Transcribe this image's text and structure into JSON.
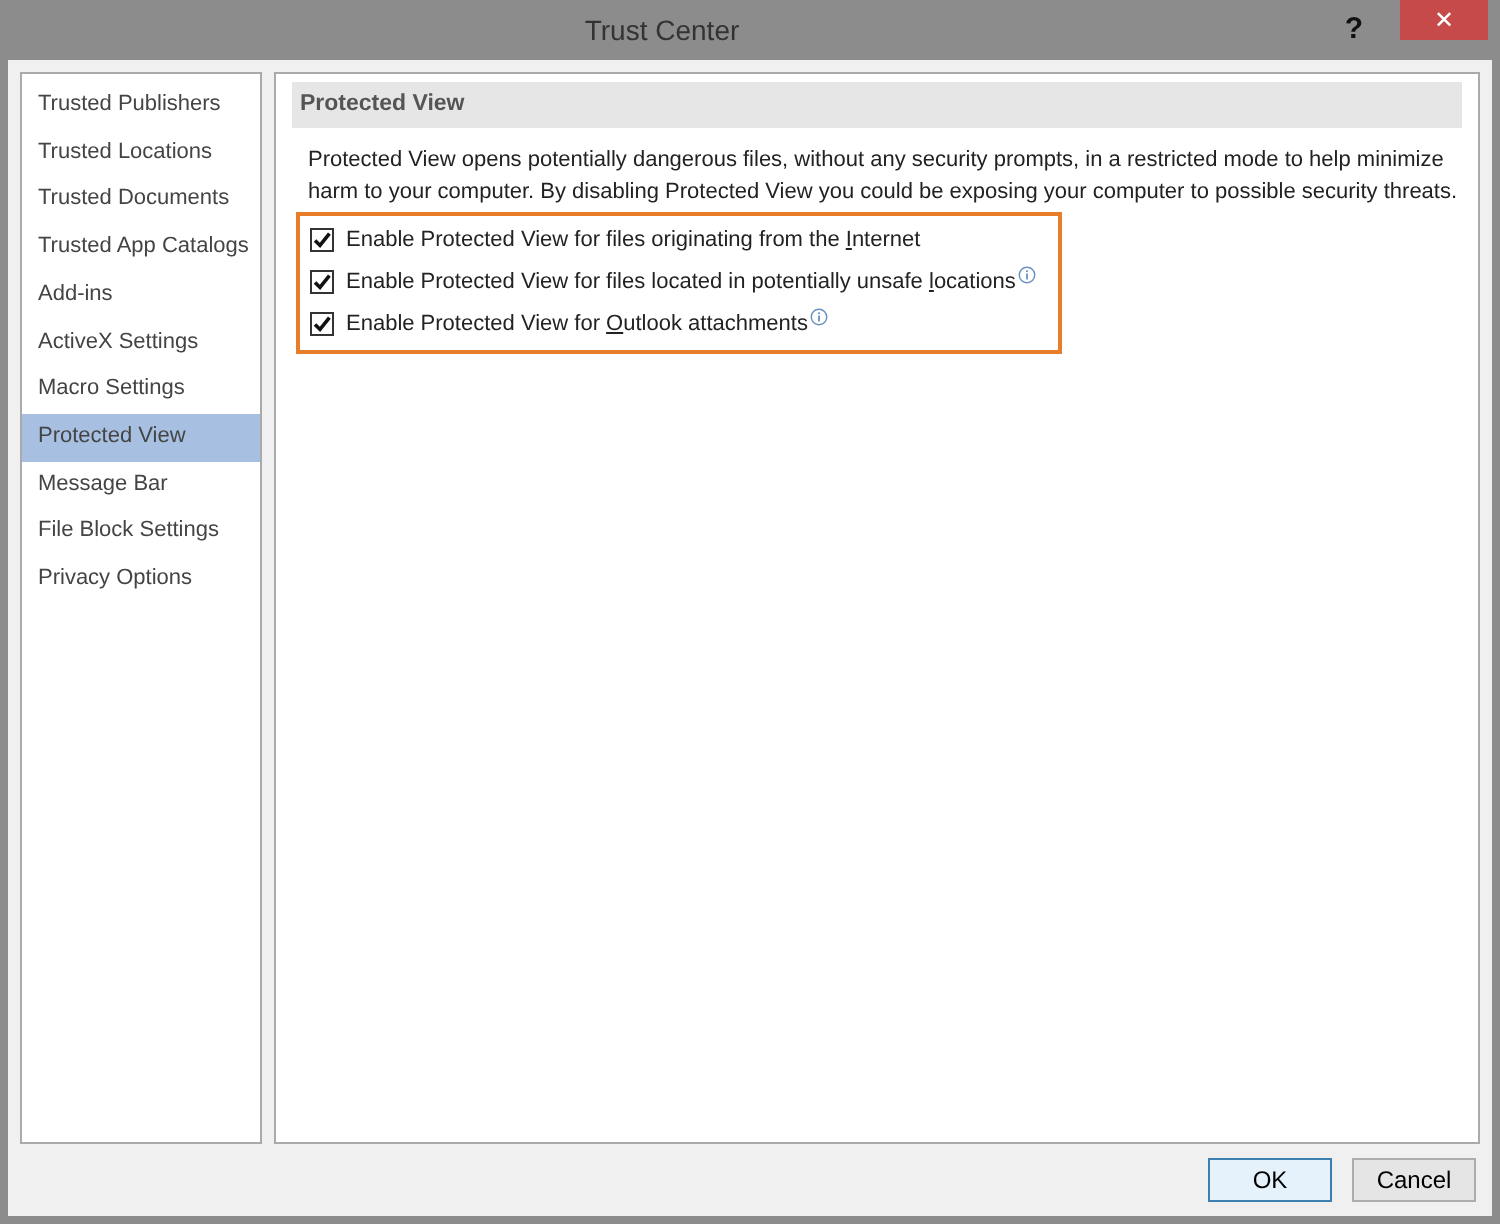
{
  "window": {
    "title": "Trust Center",
    "help": "?",
    "close": "✕"
  },
  "sidebar": {
    "items": [
      {
        "label": "Trusted Publishers",
        "selected": false
      },
      {
        "label": "Trusted Locations",
        "selected": false
      },
      {
        "label": "Trusted Documents",
        "selected": false
      },
      {
        "label": "Trusted App Catalogs",
        "selected": false
      },
      {
        "label": "Add-ins",
        "selected": false
      },
      {
        "label": "ActiveX Settings",
        "selected": false
      },
      {
        "label": "Macro Settings",
        "selected": false
      },
      {
        "label": "Protected View",
        "selected": true
      },
      {
        "label": "Message Bar",
        "selected": false
      },
      {
        "label": "File Block Settings",
        "selected": false
      },
      {
        "label": "Privacy Options",
        "selected": false
      }
    ]
  },
  "section": {
    "heading": "Protected View",
    "description": "Protected View opens potentially dangerous files, without any security prompts, in a restricted mode to help minimize harm to your computer. By disabling Protected View you could be exposing your computer to possible security threats.",
    "highlighted": true,
    "options": [
      {
        "label_before": "Enable Protected View for files originating from the ",
        "access_key": "I",
        "label_after": "nternet",
        "checked": true,
        "info": false
      },
      {
        "label_before": "Enable Protected View for files located in potentially unsafe ",
        "access_key": "l",
        "label_after": "ocations",
        "checked": true,
        "info": true
      },
      {
        "label_before": "Enable Protected View for ",
        "access_key": "O",
        "label_after": "utlook attachments",
        "checked": true,
        "info": true
      }
    ]
  },
  "buttons": [
    {
      "label": "OK",
      "kind": "default"
    },
    {
      "label": "Cancel",
      "kind": "normal"
    }
  ]
}
